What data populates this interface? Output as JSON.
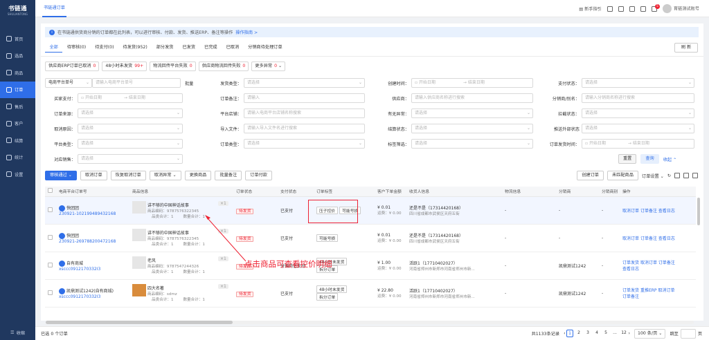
{
  "brand": {
    "name": "书链通",
    "sub": "SHULIANTONG"
  },
  "sidebar": {
    "items": [
      {
        "label": "首页",
        "icon": "home-icon"
      },
      {
        "label": "选品",
        "icon": "select-icon"
      },
      {
        "label": "商品",
        "icon": "goods-icon"
      },
      {
        "label": "订单",
        "icon": "order-icon",
        "active": true
      },
      {
        "label": "售后",
        "icon": "aftersale-icon"
      },
      {
        "label": "客户",
        "icon": "customer-icon"
      },
      {
        "label": "结算",
        "icon": "settle-icon"
      },
      {
        "label": "统计",
        "icon": "stats-icon"
      },
      {
        "label": "设置",
        "icon": "settings-icon"
      }
    ],
    "collapse": "收缩"
  },
  "topbar": {
    "tab": "书链通订单",
    "guide": "新手指引",
    "badge": "5",
    "user": "育链测试账号"
  },
  "notice": {
    "text": "在书链通供货商分销的订单都在此列表，可以进行审核、付款、发货、推送ERP、备注等操作",
    "link": "操作指南 >"
  },
  "tabs": [
    "全部",
    "待审核(0)",
    "待支付(0)",
    "待发货(952)",
    "部分发货",
    "已发货",
    "已完成",
    "已取消",
    "分销商待处理订单"
  ],
  "refresh": "刷 新",
  "quick": [
    {
      "label": "供应商ERP订单已取消",
      "count": "0"
    },
    {
      "label": "48小时未发货",
      "count": "99+"
    },
    {
      "label": "物流回传平台失败",
      "count": "0"
    },
    {
      "label": "供应商物流回传失败",
      "count": "0"
    },
    {
      "label": "更多异常",
      "count": "0"
    }
  ],
  "filters": {
    "r1": {
      "a_label": "电商平台单号",
      "a_ph": "请输入电商平台单号",
      "a_btn": "批量",
      "b_label": "发货类型：",
      "b_ph": "请选择",
      "c_label": "创建时间：",
      "c_start": "开始日期",
      "c_end": "结束日期",
      "d_label": "支付状态：",
      "d_ph": "请选择"
    },
    "r2": {
      "a_label": "买家支付：",
      "a_start": "开始日期",
      "a_end": "结束日期",
      "b_label": "订单备注：",
      "b_ph": "请输入",
      "c_label": "供应商：",
      "c_ph": "请输入供应商名称进行搜索",
      "d_label": "分销商/别名：",
      "d_ph": "请输入分销商名称进行搜索"
    },
    "r3": {
      "a_label": "订单来源：",
      "a_ph": "请选择",
      "b_label": "平台店铺：",
      "b_ph": "请输入电商平台店铺名称搜索",
      "c_label": "有无异常：",
      "c_ph": "请选择",
      "d_label": "拦截状态：",
      "d_ph": "请选择"
    },
    "r4": {
      "a_label": "取消原因：",
      "a_ph": "请选择",
      "b_label": "导入文件：",
      "b_ph": "请输入导入文件名进行搜索",
      "c_label": "结算状态：",
      "c_ph": "请选择",
      "d_label": "推送外部状态",
      "d_ph": "请选择"
    },
    "r5": {
      "a_label": "平台类型：",
      "a_ph": "请选择",
      "b_label": "订单类型：",
      "b_ph": "请选择",
      "c_label": "标签筛选：",
      "c_ph": "请选择",
      "d_label": "订单发货时间：",
      "d_start": "开始日期",
      "d_end": "结束日期"
    },
    "r6": {
      "a_label": "对应销售：",
      "a_ph": "请选择",
      "reset": "重置",
      "search": "查询",
      "collapse": "收起"
    }
  },
  "actions": [
    "审核通过",
    "取消订单",
    "恢复取消订单",
    "取消异常",
    "更换商品",
    "批量备注",
    "订单付款"
  ],
  "tools": {
    "create": "创建订单",
    "unmatched": "未匹配商品",
    "settings": "订单设置"
  },
  "columns": [
    "电商平台订单号",
    "商品信息",
    "订单状态",
    "支付状态",
    "订单标签",
    "客户下单金额",
    "收货人信息",
    "物流信息",
    "分销商",
    "分销商别",
    "操作"
  ],
  "rows": [
    {
      "shop": "快团团",
      "order": "230921-102199489432168",
      "title": "讲不够的中国神话故事",
      "isbn": "商品编码：9787576322345",
      "qty": "×1",
      "goods_total": "品类合计：1",
      "qty_total": "数量合计：1",
      "status": "待发货",
      "pay": "已支付",
      "tags": [
        "压子控价",
        "可能号损"
      ],
      "amount": "¥ 0.01",
      "freight": "运费：¥ 0.00",
      "receiver": "还是不是（17314420168）",
      "addr": "四川省成都市武侯区天府五街",
      "logistics": "-",
      "dist": "-",
      "alias": "-",
      "ops": [
        "取消订单",
        "订单备注",
        "查看日志"
      ]
    },
    {
      "shop": "快团团",
      "order": "230921-269788200472168",
      "title": "讲不够的中国神话故事",
      "isbn": "商品编码：9787576322345",
      "qty": "×1",
      "goods_total": "品类合计：1",
      "qty_total": "数量合计：1",
      "status": "待发货",
      "pay": "已支付",
      "tags": [
        "可能号损"
      ],
      "amount": "¥ 0.01",
      "freight": "运费：¥ 0.00",
      "receiver": "还是不是（17314420168）",
      "addr": "四川省成都市武侯区天府五街",
      "logistics": "-",
      "dist": "-",
      "alias": "-",
      "ops": [
        "取消订单",
        "订单备注",
        "查看日志"
      ]
    },
    {
      "shop": "自有商城",
      "order": "xsccc0912170332I3",
      "title": "老风",
      "isbn": "商品编码：9787547244326",
      "qty": "×1",
      "goods_total": "品类合计：1",
      "qty_total": "数量合计：1",
      "status": "待发货",
      "pay": "分销商已支付",
      "tags": [
        "48小时未发货",
        "拆分订单"
      ],
      "amount": "¥ 1.00",
      "freight": "运费：¥ 0.00",
      "receiver": "活跃1（17710402027）",
      "addr": "河南省郑州市新郑市河南省郑州市新...",
      "logistics": "-",
      "dist": "凯鼎测试1242",
      "alias": "-",
      "ops": [
        "订单发货",
        "取消订单",
        "订单备注",
        "查看日志"
      ]
    },
    {
      "shop": "凯鼎测试1242(自有商城)",
      "order": "xsccc0912170332I3",
      "title": "四大名著",
      "isbn": "商品编码：sdmz",
      "qty": "×1",
      "goods_total": "品类合计：1",
      "qty_total": "数量合计：1",
      "status": "待发货",
      "pay": "已支付",
      "tags": [
        "48小时未发货",
        "拆分订单"
      ],
      "amount": "¥ 22.80",
      "freight": "运费：¥ 0.00",
      "receiver": "活跃1（17710402027）",
      "addr": "河南省郑州市新郑市河南省郑州市新...",
      "logistics": "-",
      "dist": "凯鼎测试1242",
      "alias": "-",
      "ops": [
        "订单发货",
        "重推ERP",
        "取消订单",
        "订单备注"
      ]
    }
  ],
  "annotation": "点击商品可查看控价明细",
  "footer": {
    "selected": "已选 0 个订单",
    "total": "共1133条记录",
    "pages": [
      "1",
      "2",
      "3",
      "4",
      "5",
      "...",
      "12"
    ],
    "per": "100 条/页",
    "jump": "跳至",
    "page_unit": "页"
  }
}
